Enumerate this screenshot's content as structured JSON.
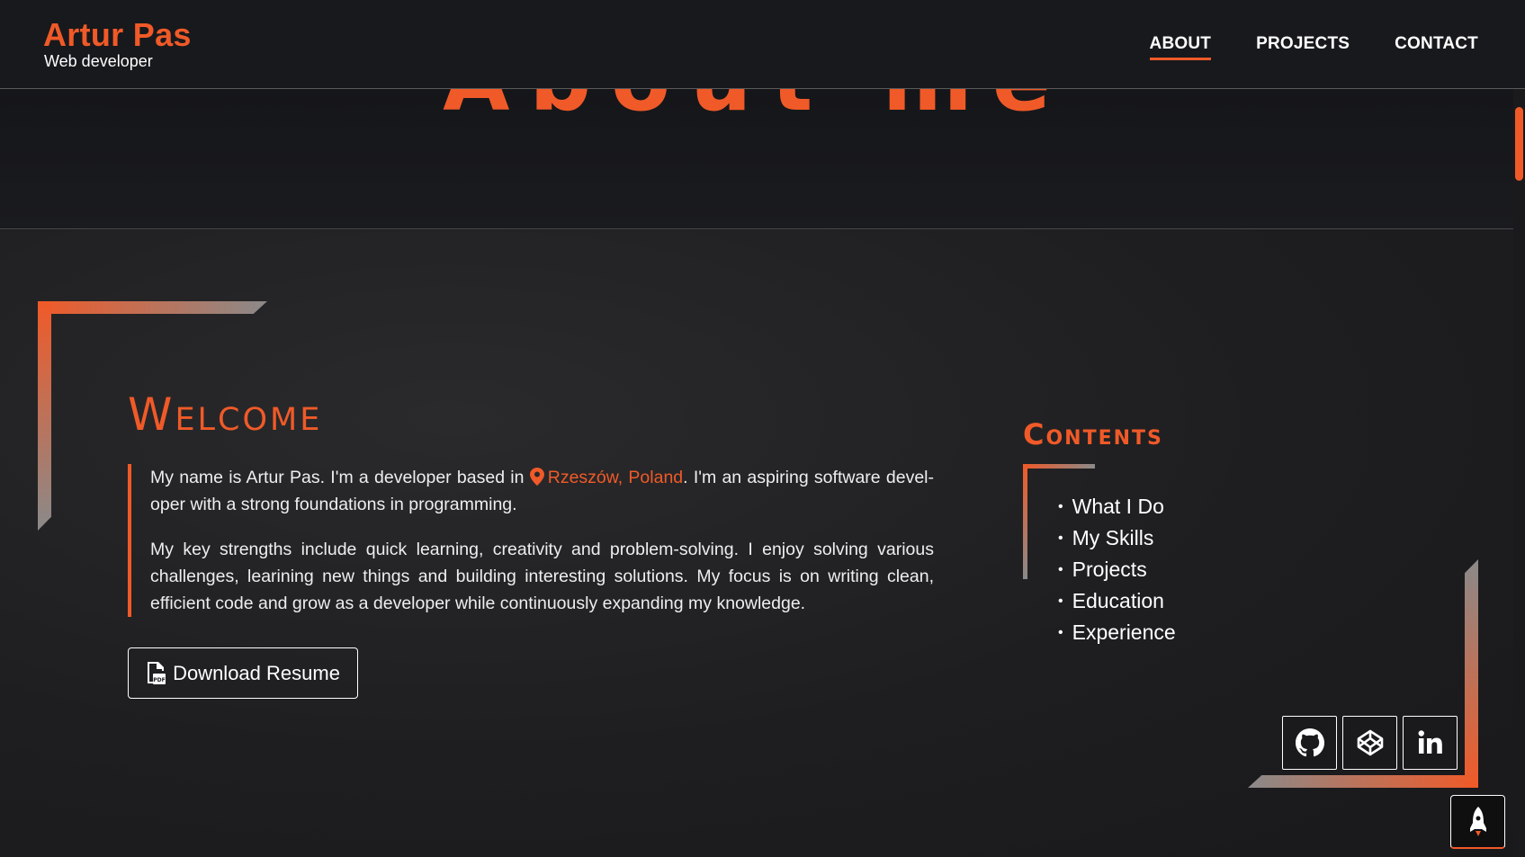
{
  "header": {
    "name": "Artur Pas",
    "subtitle": "Web developer",
    "nav": [
      {
        "label": "ABOUT",
        "active": true
      },
      {
        "label": "PROJECTS",
        "active": false
      },
      {
        "label": "CONTACT",
        "active": false
      }
    ]
  },
  "hero": {
    "title": "About me"
  },
  "welcome": {
    "title": "Welcome",
    "para1_before": "My name is Artur Pas. I'm a developer based in ",
    "location": "Rzeszów, Poland",
    "para1_after": ". I'm an aspiring software devel­oper with a strong foundations in programming.",
    "para2": "My key strengths include quick learning, creativity and problem-solving. I enjoy solving various challenges, learining new things and building interesting solutions. My focus is on writing clean, efficient code and grow as a developer while continuously expanding my knowledge.",
    "download_label": "Download Resume"
  },
  "contents": {
    "title": "Contents",
    "items": [
      "What I Do",
      "My Skills",
      "Projects",
      "Education",
      "Experience"
    ]
  },
  "social": [
    "github-icon",
    "codepen-icon",
    "linkedin-icon"
  ],
  "colors": {
    "accent": "#f05a28",
    "background": "#1c1c1e"
  }
}
